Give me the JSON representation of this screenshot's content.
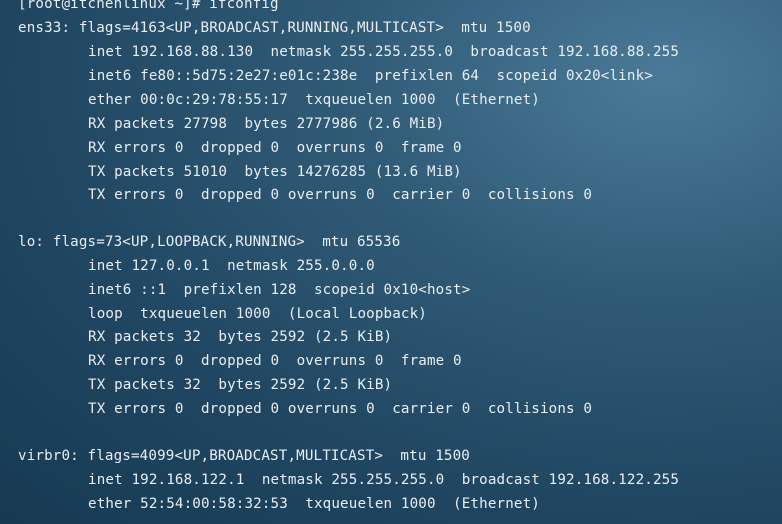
{
  "terminal": {
    "prompt": "[root@itchenlinux ~]# ifconfig",
    "interfaces": [
      {
        "header": "ens33: flags=4163<UP,BROADCAST,RUNNING,MULTICAST>  mtu 1500",
        "lines": [
          "inet 192.168.88.130  netmask 255.255.255.0  broadcast 192.168.88.255",
          "inet6 fe80::5d75:2e27:e01c:238e  prefixlen 64  scopeid 0x20<link>",
          "ether 00:0c:29:78:55:17  txqueuelen 1000  (Ethernet)",
          "RX packets 27798  bytes 2777986 (2.6 MiB)",
          "RX errors 0  dropped 0  overruns 0  frame 0",
          "TX packets 51010  bytes 14276285 (13.6 MiB)",
          "TX errors 0  dropped 0 overruns 0  carrier 0  collisions 0"
        ]
      },
      {
        "header": "lo: flags=73<UP,LOOPBACK,RUNNING>  mtu 65536",
        "lines": [
          "inet 127.0.0.1  netmask 255.0.0.0",
          "inet6 ::1  prefixlen 128  scopeid 0x10<host>",
          "loop  txqueuelen 1000  (Local Loopback)",
          "RX packets 32  bytes 2592 (2.5 KiB)",
          "RX errors 0  dropped 0  overruns 0  frame 0",
          "TX packets 32  bytes 2592 (2.5 KiB)",
          "TX errors 0  dropped 0 overruns 0  carrier 0  collisions 0"
        ]
      },
      {
        "header": "virbr0: flags=4099<UP,BROADCAST,MULTICAST>  mtu 1500",
        "lines": [
          "inet 192.168.122.1  netmask 255.255.255.0  broadcast 192.168.122.255",
          "ether 52:54:00:58:32:53  txqueuelen 1000  (Ethernet)"
        ]
      }
    ]
  }
}
